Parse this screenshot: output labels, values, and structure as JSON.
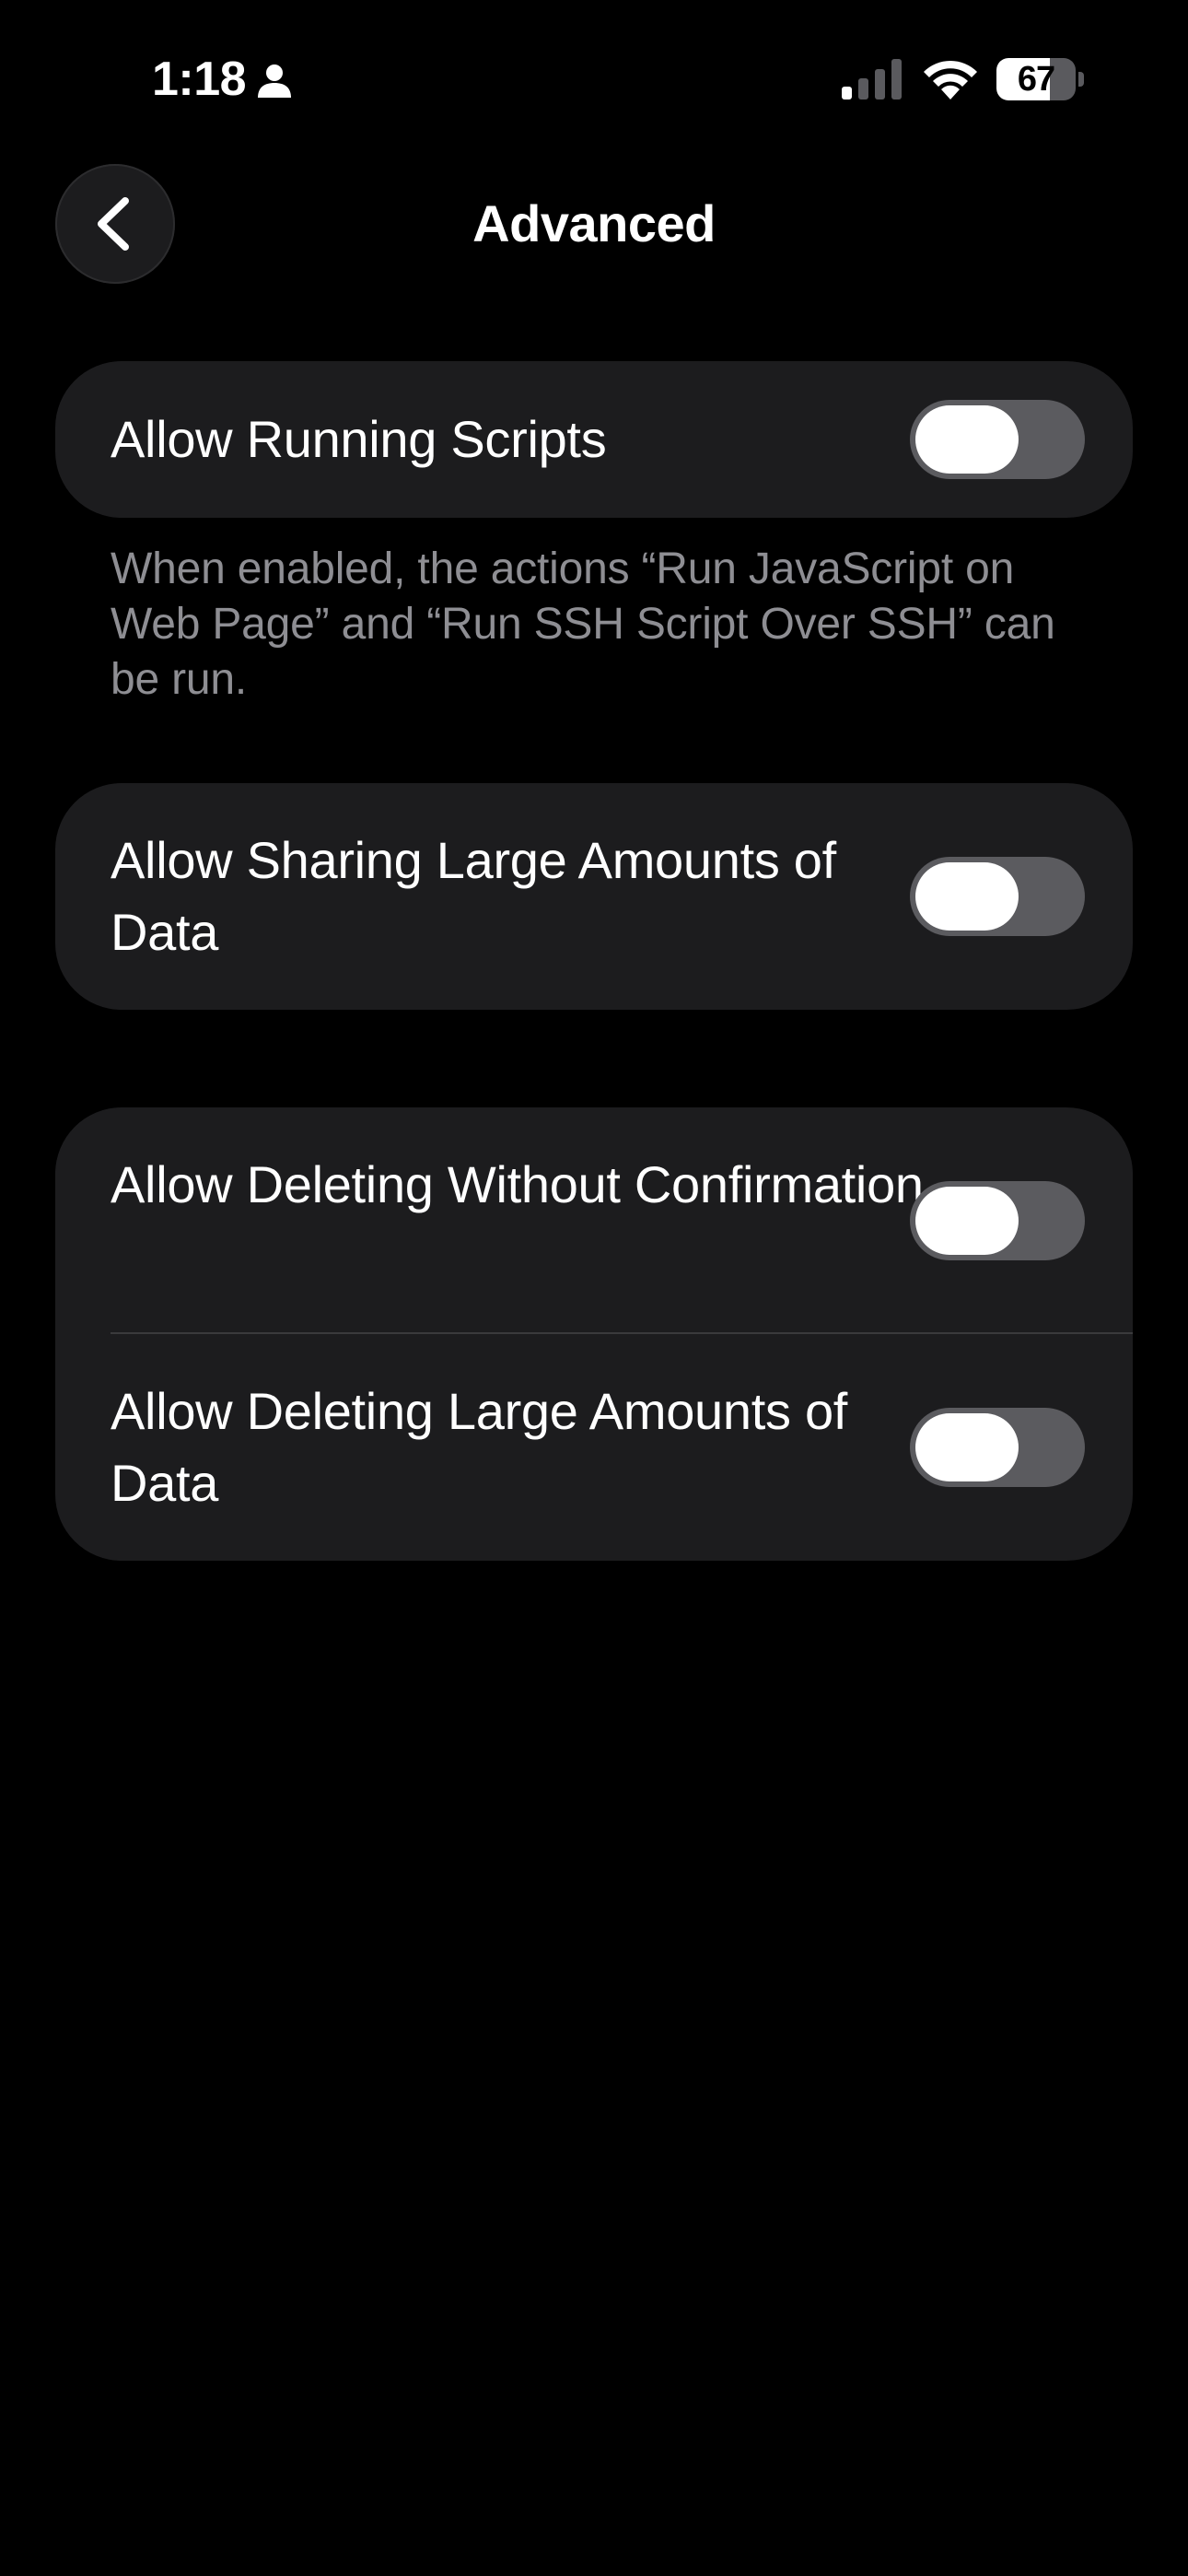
{
  "status_bar": {
    "time": "1:18",
    "battery_percent": "67",
    "battery_level": 0.67,
    "signal_bars_active": 1,
    "icons": [
      "person-icon",
      "cellular-signal-icon",
      "wifi-icon",
      "battery-icon"
    ]
  },
  "nav": {
    "back_icon": "chevron-left-icon",
    "title": "Advanced"
  },
  "groups": [
    {
      "rows": [
        {
          "label": "Allow Running Scripts",
          "enabled": false
        }
      ],
      "footer": "When enabled, the actions “Run JavaScript on Web Page” and “Run SSH Script Over SSH” can be run."
    },
    {
      "rows": [
        {
          "label": "Allow Sharing Large Amounts of Data",
          "enabled": false
        }
      ]
    },
    {
      "rows": [
        {
          "label": "Allow Deleting Without Confirmation",
          "enabled": false
        },
        {
          "label": "Allow Deleting Large Amounts of Data",
          "enabled": false
        }
      ]
    }
  ],
  "colors": {
    "background": "#000000",
    "group_background": "#1c1c1e",
    "toggle_off": "#5b5b5f",
    "secondary_text": "#8e8e93"
  }
}
